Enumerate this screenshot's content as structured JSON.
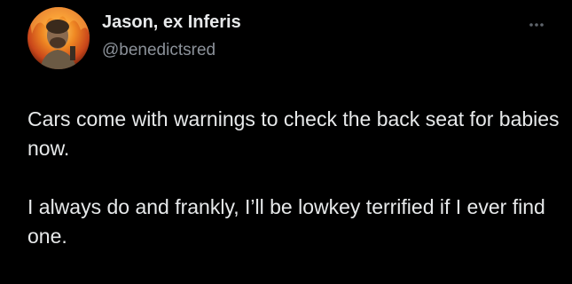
{
  "colors": {
    "background": "#000000",
    "text": "#e7e9ea",
    "secondary": "#8b9199",
    "avatar_fire": "#e8621a"
  },
  "author": {
    "display_name": "Jason, ex Inferis",
    "handle": "@benedictsred",
    "avatar_icon": "avatar-fire-portrait"
  },
  "menu": {
    "icon": "more-horizontal-icon"
  },
  "tweet": {
    "paragraphs": [
      "Cars come with warnings to check the back seat for babies now.",
      "I always do and frankly, I’ll be lowkey terrified if I ever find one."
    ]
  }
}
